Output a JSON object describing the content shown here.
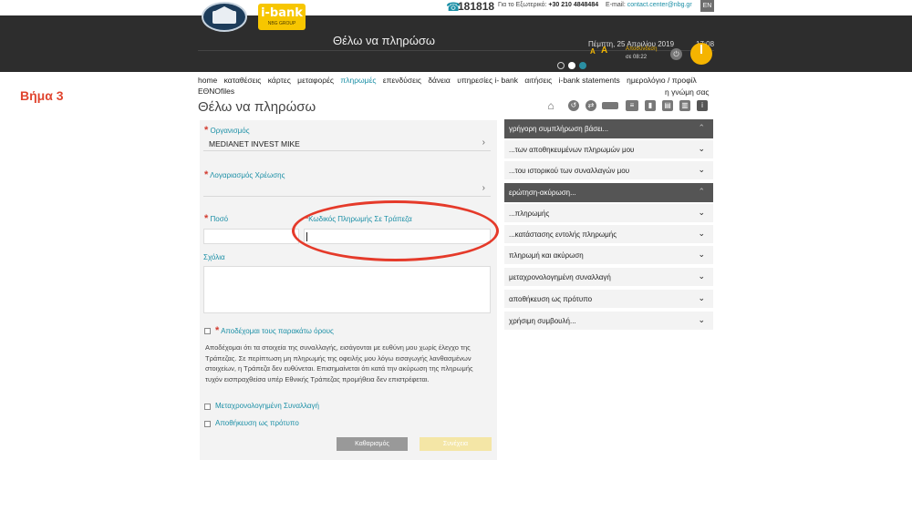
{
  "step_label": "Βήμα 3",
  "topbar": {
    "phone_number": "181818",
    "abroad_label": "Για το Εξωτερικό:",
    "abroad_number": "+30 210 4848484",
    "email_label": "E-mail:",
    "email": "contact.center@nbg.gr",
    "language": "EN",
    "ibank_logo": "i-bank",
    "ibank_logo_sub": "NBG GROUP"
  },
  "header": {
    "title": "Θέλω να πληρώσω",
    "date": "Πέμπτη, 25 Απριλίου 2019",
    "time": "17:08",
    "font_small": "A",
    "font_large": "A",
    "logout_label": "Αποσύνδεση",
    "session_time": "σε 08:22"
  },
  "nav": {
    "items": [
      "home",
      "καταθέσεις",
      "κάρτες",
      "μεταφορές",
      "πληρωμές",
      "επενδύσεις",
      "δάνεια",
      "υπηρεσίες i- bank",
      "αιτήσεις",
      "i-bank statements",
      "ημερολόγιο / προφίλ"
    ],
    "active": "πληρωμές",
    "second_row": "ΕΘΝΟfiles",
    "opinion": "η γνώμη σας"
  },
  "page_title": "Θέλω να πληρώσω",
  "form": {
    "organization_label": "Οργανισμός",
    "organization_value": "MEDIANET INVEST MIKE",
    "debit_account_label": "Λογαριασμός Χρέωσης",
    "debit_account_value": "",
    "amount_label": "Ποσό",
    "amount_value": "",
    "payment_code_label": "Κωδικός Πληρωμής Σε Τράπεζα",
    "payment_code_value": "",
    "comments_label": "Σχόλια",
    "comments_value": "",
    "accept_terms_label": "Αποδέχομαι τους παρακάτω όρους",
    "terms_text": "Αποδέχομαι ότι τα στοιχεία της συναλλαγής, εισάγονται με ευθύνη μου χωρίς έλεγχο της Τράπεζας. Σε περίπτωση μη πληρωμής της οφειλής μου λόγω εισαγωγής λανθασμένων στοιχείων, η Τράπεζα δεν ευθύνεται. Επισημαίνεται ότι κατά την ακύρωση της πληρωμής τυχόν εισπραχθείσα υπέρ Εθνικής Τράπεζας προμήθεια δεν επιστρέφεται.",
    "scheduled_label": "Μεταχρονολογημένη Συναλλαγή",
    "save_template_label": "Αποθήκευση ως πρότυπο",
    "clear_button": "Καθαρισμός",
    "continue_button": "Συνέχεια"
  },
  "side_panel": {
    "group1_title": "γρήγορη συμπλήρωση βάσει...",
    "group1_items": [
      "...των αποθηκευμένων πληρωμών μου",
      "...του ιστορικού των συναλλαγών μου"
    ],
    "group2_title": "ερώτηση-ακύρωση...",
    "group2_items": [
      "...πληρωμής",
      "...κατάστασης εντολής πληρωμής"
    ],
    "other_items": [
      "πληρωμή και ακύρωση",
      "μεταχρονολογημένη συναλλαγή",
      "αποθήκευση ως πρότυπο",
      "χρήσιμη συμβουλή..."
    ]
  },
  "colors": {
    "accent": "#1b8fa6",
    "header_bg": "#2d2d2d",
    "required": "#d23b2f",
    "highlight_ellipse": "#e53a2a",
    "brand_yellow": "#f7c600"
  }
}
